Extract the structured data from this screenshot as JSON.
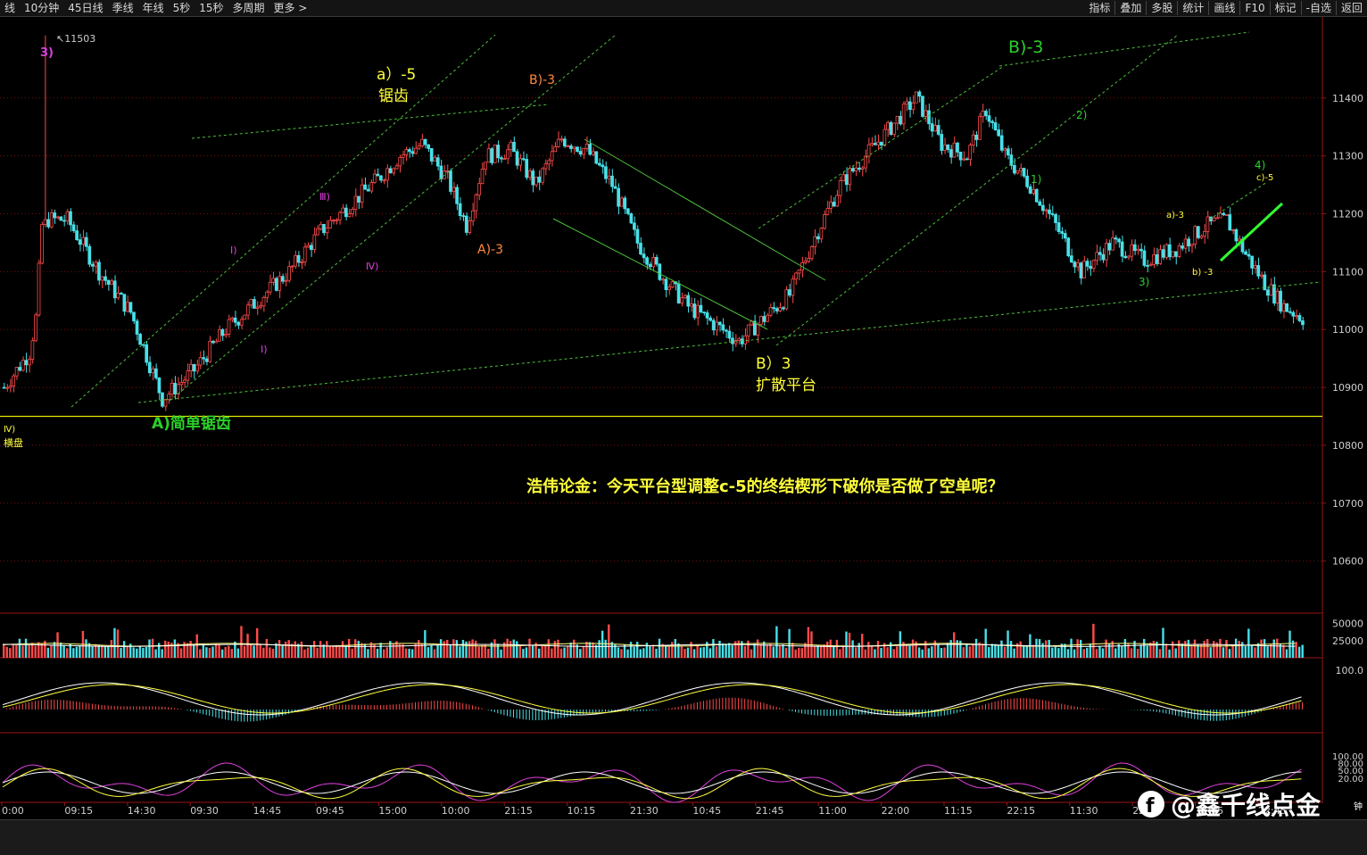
{
  "toolbar": {
    "left": [
      "线",
      "10分钟",
      "45日线",
      "季线",
      "年线",
      "5秒",
      "15秒",
      "多周期",
      "更多 >"
    ],
    "right": [
      "指标",
      "叠加",
      "多股",
      "统计",
      "画线",
      "F10",
      "标记",
      "-自选",
      "返回"
    ]
  },
  "colors": {
    "bull": "#ff4a4a",
    "bear": "#48e0e8",
    "grid": "#7a1010",
    "trend": "#4cbf3a",
    "label_yellow": "#ffff3a",
    "label_green": "#2ad02a",
    "label_orange": "#ff8a3a",
    "label_magenta": "#e040e0",
    "axis_text": "#cfcfcf"
  },
  "chart_data": [
    {
      "type": "candlestick",
      "title": "",
      "ylim": [
        10510,
        11540
      ],
      "y_ticks": [
        11400,
        11300,
        11200,
        11100,
        11000,
        10900,
        10800,
        10700,
        10600
      ],
      "y_tick_labels": [
        "11400",
        "11300",
        "11200",
        "11100",
        "11000",
        "10900",
        "10800",
        "10700",
        "10600"
      ],
      "x_tick_labels": [
        "0:00",
        "09:15",
        "14:30",
        "09:30",
        "14:45",
        "09:45",
        "15:00",
        "10:00",
        "21:15",
        "10:15",
        "21:30",
        "10:45",
        "21:45",
        "11:00",
        "22:00",
        "11:15",
        "22:15",
        "11:30",
        "22:30",
        "11:45",
        "22:45"
      ],
      "high_marker": "11503",
      "horizontal_line": 10850,
      "anchors": [
        [
          0,
          10900
        ],
        [
          8,
          10960
        ],
        [
          10,
          11020
        ],
        [
          12,
          11180
        ],
        [
          13,
          11300
        ],
        [
          14,
          11190
        ],
        [
          20,
          11190
        ],
        [
          30,
          11100
        ],
        [
          40,
          11030
        ],
        [
          50,
          10880
        ],
        [
          60,
          10930
        ],
        [
          70,
          11000
        ],
        [
          80,
          11050
        ],
        [
          90,
          11100
        ],
        [
          100,
          11170
        ],
        [
          110,
          11220
        ],
        [
          118,
          11260
        ],
        [
          125,
          11300
        ],
        [
          132,
          11320
        ],
        [
          140,
          11260
        ],
        [
          146,
          11180
        ],
        [
          152,
          11300
        ],
        [
          160,
          11310
        ],
        [
          168,
          11250
        ],
        [
          176,
          11330
        ],
        [
          184,
          11310
        ],
        [
          192,
          11250
        ],
        [
          200,
          11150
        ],
        [
          208,
          11090
        ],
        [
          216,
          11040
        ],
        [
          224,
          11010
        ],
        [
          232,
          10980
        ],
        [
          240,
          11020
        ],
        [
          248,
          11060
        ],
        [
          256,
          11160
        ],
        [
          264,
          11250
        ],
        [
          272,
          11300
        ],
        [
          280,
          11350
        ],
        [
          288,
          11400
        ],
        [
          296,
          11320
        ],
        [
          304,
          11300
        ],
        [
          310,
          11380
        ],
        [
          316,
          11300
        ],
        [
          324,
          11250
        ],
        [
          332,
          11180
        ],
        [
          340,
          11100
        ],
        [
          350,
          11150
        ],
        [
          360,
          11120
        ],
        [
          370,
          11140
        ],
        [
          380,
          11180
        ],
        [
          386,
          11190
        ],
        [
          392,
          11130
        ],
        [
          398,
          11080
        ],
        [
          404,
          11040
        ],
        [
          410,
          11020
        ]
      ],
      "wave_labels": [
        {
          "text": "3)",
          "color": "magenta"
        },
        {
          "text": "a）-5",
          "color": "yellow"
        },
        {
          "text": "锯齿",
          "color": "yellow"
        },
        {
          "text": "B)-3",
          "color": "orange"
        },
        {
          "text": "A)-3",
          "color": "orange"
        },
        {
          "text": "B)-3",
          "color": "green"
        },
        {
          "text": "Ⅰ)",
          "color": "magenta"
        },
        {
          "text": "Ⅲ)",
          "color": "magenta"
        },
        {
          "text": "Ⅳ)",
          "color": "magenta"
        },
        {
          "text": "Ⅰ)",
          "color": "magenta"
        },
        {
          "text": "B）3",
          "color": "yellow"
        },
        {
          "text": "扩散平台",
          "color": "yellow"
        },
        {
          "text": "A)简单锯齿",
          "color": "green"
        },
        {
          "text": "Ⅳ)",
          "color": "yellow"
        },
        {
          "text": "横盘",
          "color": "yellow"
        },
        {
          "text": "1)",
          "color": "green"
        },
        {
          "text": "2)",
          "color": "green"
        },
        {
          "text": "3)",
          "color": "green"
        },
        {
          "text": "4)",
          "color": "green"
        },
        {
          "text": "a)-3",
          "color": "yellow"
        },
        {
          "text": "b) -3",
          "color": "yellow"
        },
        {
          "text": "c)-5",
          "color": "yellow"
        }
      ],
      "annotation": "浩伟论金：今天平台型调整c-5的终结楔形下破你是否做了空单呢？"
    },
    {
      "type": "bar",
      "y_ticks": [
        50000,
        25000
      ],
      "y_tick_labels": [
        "50000",
        "25000"
      ]
    },
    {
      "type": "line",
      "y_tick_labels": [
        "100.0"
      ]
    },
    {
      "type": "line",
      "y_tick_labels": [
        "100.00",
        "80.00",
        "50.00",
        "20.00"
      ]
    }
  ],
  "watermark": "@鑫千线点金",
  "status": {
    "plus": "+",
    "period_label": "钟"
  }
}
